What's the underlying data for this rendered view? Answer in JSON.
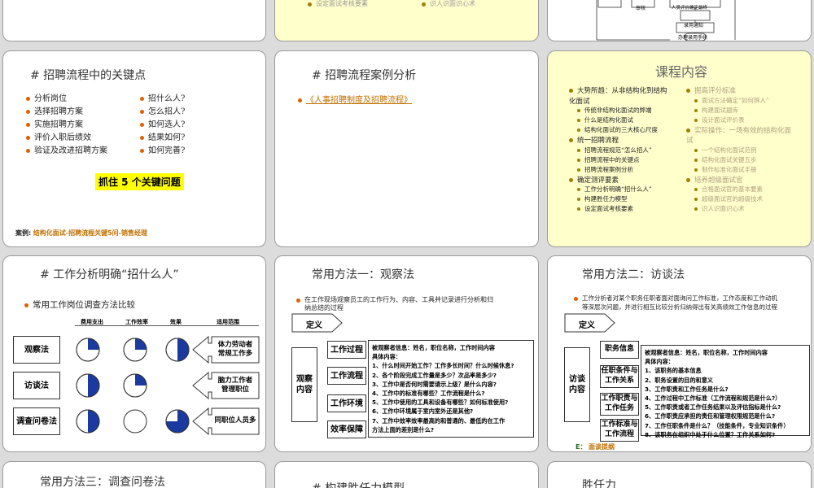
{
  "s2": {
    "items": [
      "设定面试考核要素",
      "识人识面识心术"
    ]
  },
  "s3": {
    "labels": [
      "审核",
      "人员评价确定最终",
      "录用通知",
      "办理录用手续",
      "结束"
    ]
  },
  "s4": {
    "title": "# 招聘流程中的关键点",
    "left_items": [
      "分析岗位",
      "选择招聘方案",
      "实施招聘方案",
      "评价入职后绩效",
      "验证及改进招聘方案"
    ],
    "right_items": [
      "招什么人?",
      "怎么招人?",
      "如何选人?",
      "结果如何?",
      "如何完善?"
    ],
    "highlight": "抓住 5 个关键问题",
    "case_label": "案例:",
    "case_text": "结构化面试-招聘流程关键5问-销售经理"
  },
  "s5": {
    "title": "# 招聘流程案例分析",
    "link": "《人事招聘制度及招聘流程》"
  },
  "s6": {
    "title": "课程内容",
    "left": [
      {
        "level": 1,
        "text": "大势所趋：从非结构化到结构"
      },
      {
        "level": 0,
        "text": "化面试"
      },
      {
        "level": 2,
        "text": "传统非结构化面试的弊端"
      },
      {
        "level": 2,
        "text": "什么是结构化面试"
      },
      {
        "level": 2,
        "text": "结构化面试的三大核心尺度"
      },
      {
        "level": 1,
        "text": "统一招聘流程"
      },
      {
        "level": 2,
        "text": "招聘流程规范“怎么招人”"
      },
      {
        "level": 2,
        "text": "招聘流程中的关键点"
      },
      {
        "level": 2,
        "text": "招聘流程案例分析"
      },
      {
        "level": 1,
        "text": "确定测评要素"
      },
      {
        "level": 2,
        "text": "工作分析明确“招什么人”"
      },
      {
        "level": 2,
        "text": "构建胜任力模型"
      },
      {
        "level": 2,
        "text": "设定面试考核要素"
      }
    ],
    "right": [
      {
        "level": 1,
        "text": "掘高评分标准"
      },
      {
        "level": 2,
        "text": "面试方法确定“如何辨人”"
      },
      {
        "level": 2,
        "text": "构建面试题库"
      },
      {
        "level": 2,
        "text": "设计面试评价表"
      },
      {
        "level": 1,
        "text": "实际操作：一场有效的结构化面"
      },
      {
        "level": 0,
        "text": "试"
      },
      {
        "level": 2,
        "text": "一个结构化面试范例"
      },
      {
        "level": 2,
        "text": "结构化面试关键五步"
      },
      {
        "level": 2,
        "text": "制作标准化面试手册"
      },
      {
        "level": 1,
        "text": "培养超级面试官"
      },
      {
        "level": 2,
        "text": "合格面试官的基本要素"
      },
      {
        "level": 2,
        "text": "超级面试官的超级技术"
      },
      {
        "level": 2,
        "text": "识人识面识心术"
      }
    ]
  },
  "s7": {
    "title": "# 工作分析明确“招什么人”",
    "subtitle": "常用工作岗位调查方法比较",
    "headers": [
      "费用支出",
      "工作效率",
      "效果",
      "适用范围"
    ],
    "methods": [
      {
        "name": "观察法",
        "cost": 0.25,
        "eff": 0.25,
        "effect": 0.5,
        "scope": "体力劳动者\n常规工作多"
      },
      {
        "name": "访谈法",
        "cost": 0.5,
        "eff": 0.25,
        "effect": 0.0,
        "scope": "脑力工作者\n管理职位"
      },
      {
        "name": "调查问卷法",
        "cost": 0.5,
        "eff": 0.0,
        "effect": 0.75,
        "scope": "同职位人员多"
      }
    ]
  },
  "s8": {
    "title": "常用方法一：观察法",
    "intro1": "在工作现场观察员工的工作行为、内容、工具并记录进行分析和归",
    "intro2": "纳总结的过程",
    "def": "定义",
    "side": "观察\n内容",
    "tags": [
      "工作过程",
      "工作流程",
      "工作环境",
      "效率保障"
    ],
    "detail": [
      "被观察者信息：姓名，职位名称，工作时间内容",
      "具体内容：",
      "1、什么时间开始工作？工作多长时间？什么时候休息?",
      "2、各个阶段完成工作量是多少？次品率是多少?",
      "3、工作中是否何时需要请示上级？是什么内容?",
      "4、工作中的标准有哪些？工作流程是什么?",
      "5、工作中使用的工具和设备有哪些？如何标准使用?",
      "6、工作中环境属于室内室外还是其他?",
      "7、工作中效率效率最高的和普通的、最低的在工作",
      "方法上面的差别是什么?"
    ]
  },
  "s9": {
    "title": "常用方法二：访谈法",
    "intro1": "工作分析者对某个职务任职者面对面询问工作标准，工作态度和工作动机",
    "intro2": "等深层次问题，并进行相互比较分析归纳得出有关高绩效工作信息的过程",
    "def": "定义",
    "side": "访谈\n内容",
    "tags": [
      "职务信息",
      "任职条件与\n工作关系",
      "工作职责与\n工作任务",
      "工作标准与\n工作流程"
    ],
    "detail": [
      "被观察者信息：姓名，职位名称，工作时间内容",
      "具体内容：",
      "1、该职务的基本信息",
      "2、职务设置的目的和意义",
      "3、工作职责和工作任务是什么?",
      "4、工作过程中工作标准（工作流程和规范是什么?）",
      "5、工作职责或者工作任务结果以及评估指标是什么?",
      "6、工作职责应承担的责任和管理权限规范是什么?",
      "7、工作任职条件是什么？（技能条件，专业知识条件）",
      "8、该职务在组织中处于什么位置？工作关系如何?"
    ],
    "note_label": "E：",
    "note": "面谈提纲"
  },
  "s10": {
    "title": "常用方法三：调查问卷法"
  },
  "s11": {
    "title": "# 构建胜任力模型"
  },
  "s12": {
    "title": "胜任力"
  }
}
